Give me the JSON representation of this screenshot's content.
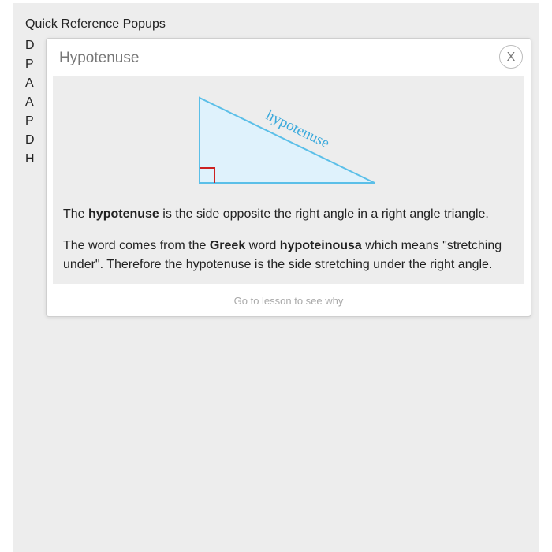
{
  "page": {
    "title": "Quick Reference Popups",
    "list_items": [
      "D",
      "P",
      "A",
      "A",
      "P",
      "D",
      "H"
    ]
  },
  "popup": {
    "title": "Hypotenuse",
    "close_label": "X",
    "diagram": {
      "label": "hypotenuse",
      "colors": {
        "triangle_stroke": "#5bbfe8",
        "triangle_fill": "#dff2fc",
        "right_angle_mark": "#cc2222",
        "label": "#3aa9dc"
      }
    },
    "paragraph1": {
      "t1": "The ",
      "b1": "hypotenuse",
      "t2": " is the side opposite the right angle in a right angle triangle."
    },
    "paragraph2": {
      "t1": "The word comes from the ",
      "b1": "Greek",
      "t2": " word ",
      "b2": "hypoteinousa",
      "t3": " which means \"stretching under\". Therefore the hypotenuse is the side stretching under the right angle."
    },
    "lesson_link": "Go to lesson to see why"
  }
}
